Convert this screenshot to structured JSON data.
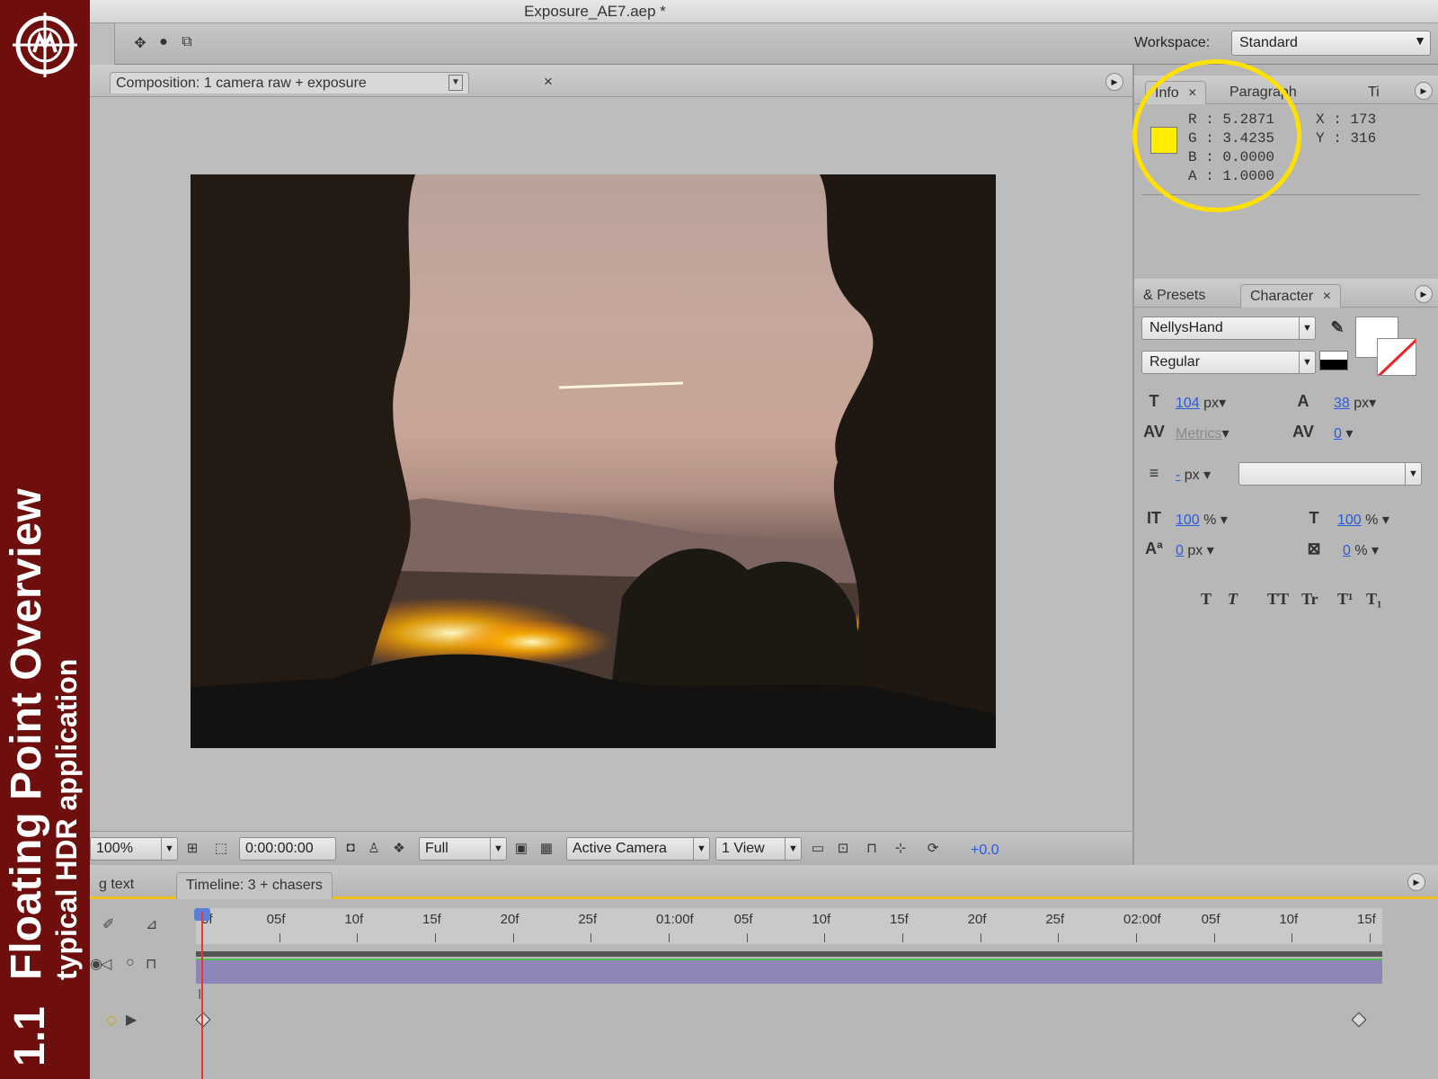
{
  "app": {
    "window_title": "Exposure_AE7.aep *",
    "workspace_label": "Workspace:",
    "workspace_value": "Standard"
  },
  "overlay": {
    "number": "1.1",
    "title": "Floating Point Overview",
    "subtitle": "typical HDR application",
    "highlight_color": "#ffe100"
  },
  "composition": {
    "tab_label": "Composition: 1 camera raw + exposure",
    "zoom": "100%",
    "timecode": "0:00:00:00",
    "resolution": "Full",
    "camera": "Active Camera",
    "views": "1 View",
    "exposure": "+0.0"
  },
  "info_panel": {
    "tabs": [
      "Info",
      "Paragraph",
      "Ti"
    ],
    "swatch_color": "#ffee00",
    "r": "R : 5.2871",
    "g": "G : 3.4235",
    "b": "B : 0.0000",
    "a": "A : 1.0000",
    "x": "X : 173",
    "y": "Y : 316"
  },
  "character_panel": {
    "tabs": [
      "& Presets",
      "Character"
    ],
    "font_family": "NellysHand",
    "font_style": "Regular",
    "font_size": "104",
    "font_size_unit": "px",
    "leading": "38",
    "leading_unit": "px",
    "kerning": "Metrics",
    "tracking": "0",
    "stroke_width": "-",
    "stroke_unit": "px",
    "vertical_scale": "100",
    "horizontal_scale": "100",
    "percent": "%",
    "baseline_shift": "0",
    "baseline_unit": "px",
    "tsume": "0",
    "format_buttons": [
      "T",
      "T",
      "TT",
      "Tr",
      "T¹",
      "T₁"
    ]
  },
  "timeline": {
    "tabs": [
      "g text",
      "Timeline: 3 + chasers"
    ],
    "ruler_labels": [
      "0f",
      "05f",
      "10f",
      "15f",
      "20f",
      "25f",
      "01:00f",
      "05f",
      "10f",
      "15f",
      "20f",
      "25f",
      "02:00f",
      "05f",
      "10f",
      "15f"
    ],
    "layer_color": "#8e86b8"
  }
}
